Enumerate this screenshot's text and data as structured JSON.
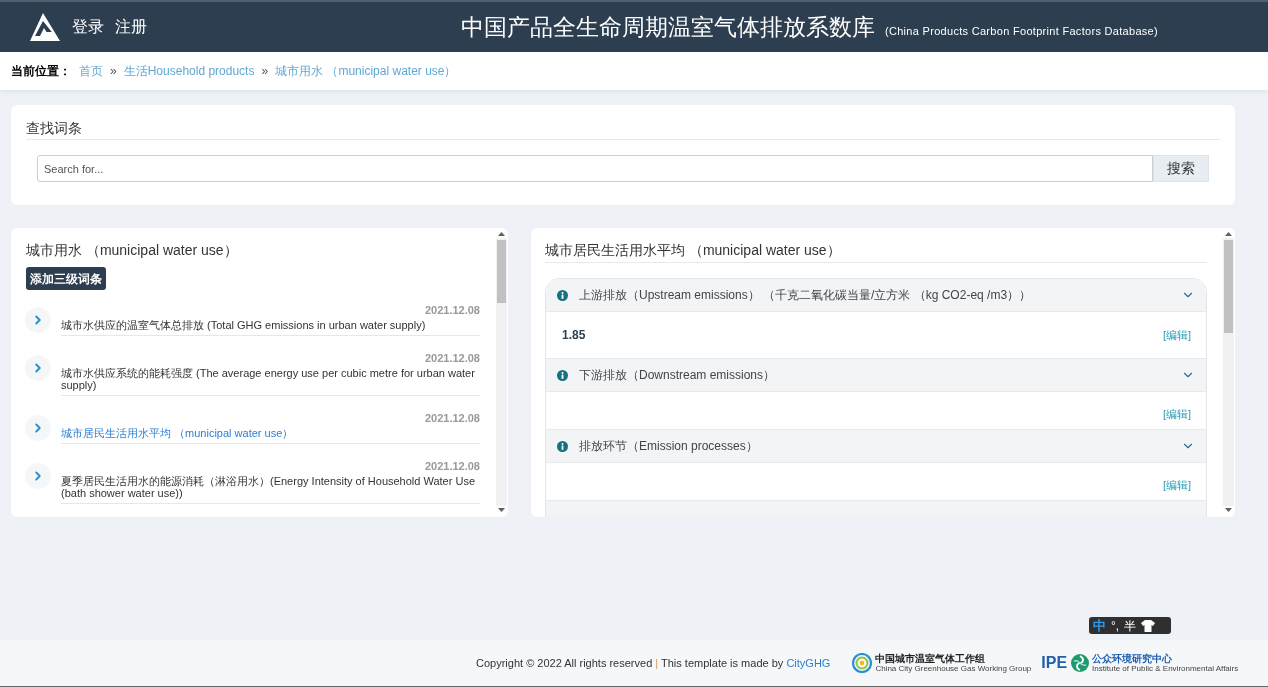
{
  "header": {
    "auth_links": [
      "登录",
      "注册"
    ],
    "title": "中国产品全生命周期温室气体排放系数库",
    "subtitle": "(China Products Carbon Footprint Factors Database)"
  },
  "breadcrumb": {
    "label": "当前位置：",
    "items": [
      {
        "kind": "link",
        "text": "首页"
      },
      {
        "kind": "separator",
        "text": "»"
      },
      {
        "kind": "link",
        "text": "生活Household products"
      },
      {
        "kind": "separator",
        "text": "»"
      },
      {
        "kind": "link",
        "text": "城市用水 （municipal water use）"
      }
    ]
  },
  "search": {
    "title": "查找词条",
    "placeholder": "Search for...",
    "button": "搜索"
  },
  "category_panel": {
    "title": "城市用水 （municipal water use）",
    "add_button": "添加三级词条",
    "entries": [
      {
        "date": "2021.12.08",
        "title": "城市水供应的温室气体总排放 (Total GHG emissions in urban water supply)",
        "selected": false
      },
      {
        "date": "2021.12.08",
        "title": "城市水供应系统的能耗强度 (The average energy use per cubic metre for urban water supply)",
        "selected": false
      },
      {
        "date": "2021.12.08",
        "title": "城市居民生活用水平均 （municipal water use）",
        "selected": true
      },
      {
        "date": "2021.12.08",
        "title": "夏季居民生活用水的能源消耗（淋浴用水）(Energy Intensity of Household Water Use (bath shower water use))",
        "selected": false
      }
    ]
  },
  "detail_panel": {
    "title": "城市居民生活用水平均 （municipal water use）",
    "sections": [
      {
        "heading": "上游排放（Upstream emissions） （千克二氧化碳当量/立方米 （kg CO2-eq /m3））",
        "value": "1.85",
        "edit_link": "[编辑]"
      },
      {
        "heading": "下游排放（Downstream emissions）",
        "edit_link": "[编辑]"
      },
      {
        "heading": "排放环节（Emission processes）",
        "edit_link": "[编辑]"
      }
    ]
  },
  "footer": {
    "copyright": "Copyright © 2022 All rights reserved",
    "divider": "|",
    "credit": "This template is made by",
    "credit_link": "CityGHG",
    "partners": [
      {
        "kind": "cityghg",
        "name": "中国城市温室气体工作组",
        "subtitle": "China City Greenhouse Gas Working Group"
      },
      {
        "kind": "ipe",
        "acronym": "IPE",
        "name": "公众环境研究中心",
        "subtitle": "Institute of Public & Environmental Affairs"
      }
    ]
  },
  "ime_indicator": {
    "mode": "中",
    "punctuation": "°,",
    "width": "半"
  }
}
